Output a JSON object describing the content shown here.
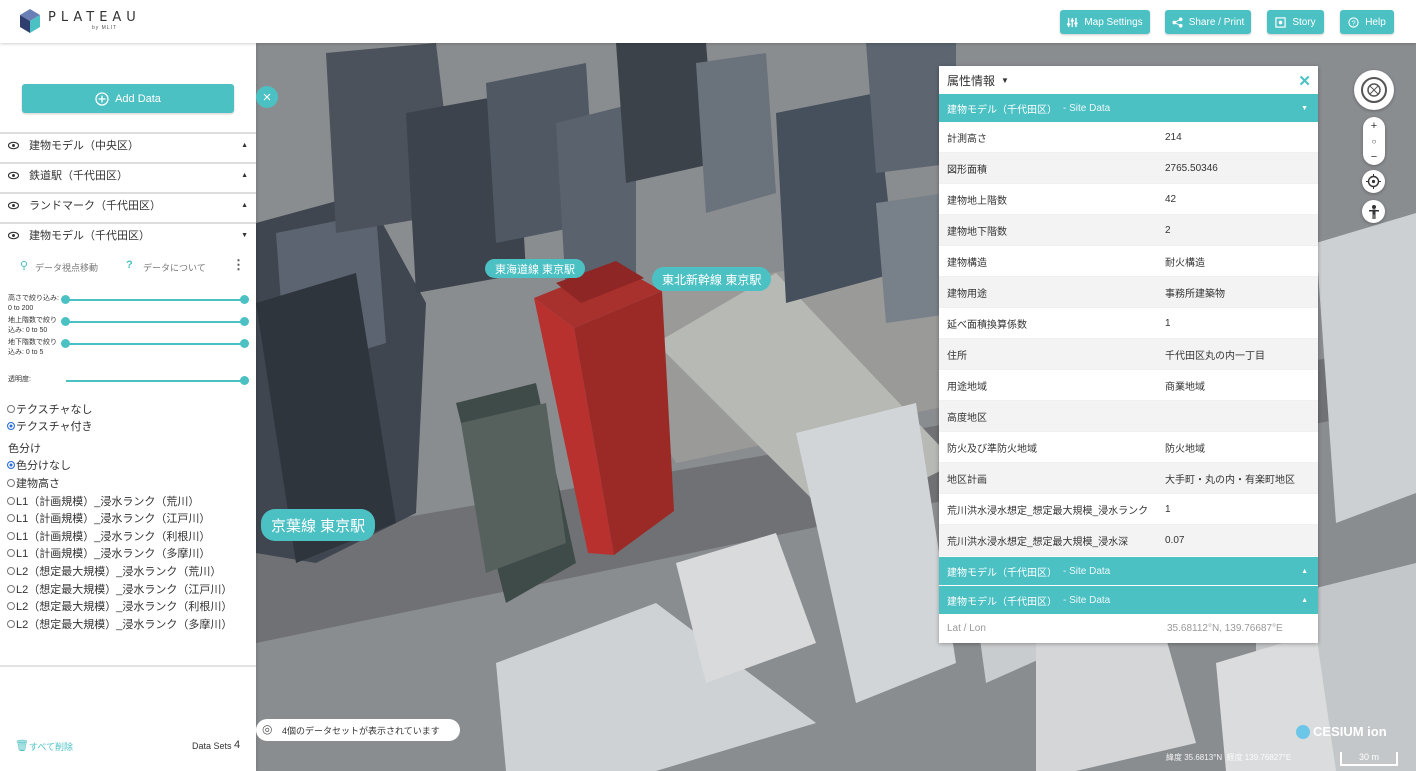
{
  "app": {
    "logo_title": "PLATEAU",
    "logo_sub": "by MLIT"
  },
  "toolbar": {
    "map_settings": "Map Settings",
    "share_print": "Share / Print",
    "story": "Story",
    "help": "Help"
  },
  "sidebar": {
    "add_data": "Add Data",
    "layers": [
      {
        "label": "建物モデル（中央区）",
        "arrow": "▲"
      },
      {
        "label": "鉄道駅（千代田区）",
        "arrow": "▲"
      },
      {
        "label": "ランドマーク（千代田区）",
        "arrow": "▲"
      },
      {
        "label": "建物モデル（千代田区）",
        "arrow": "▼"
      }
    ],
    "tools": {
      "move_view": "データ視点移動",
      "about": "データについて"
    },
    "sliders": [
      {
        "label": "高さで絞り込み:",
        "range": "0 to 200"
      },
      {
        "label": "地上階数で絞り",
        "range": "込み: 0 to 50"
      },
      {
        "label": "地下階数で絞り",
        "range": "込み: 0 to 5"
      }
    ],
    "opacity_label": "透明度:",
    "texture_options": [
      {
        "label": "テクスチャなし",
        "selected": false
      },
      {
        "label": "テクスチャ付き",
        "selected": true
      }
    ],
    "color_heading": "色分け",
    "color_options": [
      {
        "label": "色分けなし",
        "selected": true
      },
      {
        "label": "建物高さ",
        "selected": false
      },
      {
        "label": "L1（計画規模）_浸水ランク（荒川）",
        "selected": false
      },
      {
        "label": "L1（計画規模）_浸水ランク（江戸川）",
        "selected": false
      },
      {
        "label": "L1（計画規模）_浸水ランク（利根川）",
        "selected": false
      },
      {
        "label": "L1（計画規模）_浸水ランク（多摩川）",
        "selected": false
      },
      {
        "label": "L2（想定最大規模）_浸水ランク（荒川）",
        "selected": false
      },
      {
        "label": "L2（想定最大規模）_浸水ランク（江戸川）",
        "selected": false
      },
      {
        "label": "L2（想定最大規模）_浸水ランク（利根川）",
        "selected": false
      },
      {
        "label": "L2（想定最大規模）_浸水ランク（多摩川）",
        "selected": false
      }
    ],
    "delete_all": "すべて削除",
    "data_sets_label": "Data Sets",
    "data_sets_count": "4"
  },
  "map": {
    "labels": {
      "keiyo": "京葉線 東京駅",
      "tokaido": "東海道線 東京駅",
      "tohoku": "東北新幹線 東京駅"
    },
    "status": "4個のデータセットが表示されています",
    "cesium": "CESIUM ion",
    "scale": "30 m",
    "coords_lat": "緯度 35.6813°N",
    "coords_lon": "経度 139.76827°E"
  },
  "feature_info": {
    "title": "属性情報",
    "section_title": "建物モデル（千代田区）",
    "section_sub": "- Site Data",
    "rows": [
      {
        "key": "計測高さ",
        "value": "214"
      },
      {
        "key": "図形面積",
        "value": "2765.50346"
      },
      {
        "key": "建物地上階数",
        "value": "42"
      },
      {
        "key": "建物地下階数",
        "value": "2"
      },
      {
        "key": "建物構造",
        "value": "耐火構造"
      },
      {
        "key": "建物用途",
        "value": "事務所建築物"
      },
      {
        "key": "延べ面積換算係数",
        "value": "1"
      },
      {
        "key": "住所",
        "value": "千代田区丸の内一丁目"
      },
      {
        "key": "用途地域",
        "value": "商業地域"
      },
      {
        "key": "高度地区",
        "value": ""
      },
      {
        "key": "防火及び準防火地域",
        "value": "防火地域"
      },
      {
        "key": "地区計画",
        "value": "大手町・丸の内・有楽町地区"
      },
      {
        "key": "荒川洪水浸水想定_想定最大規模_浸水ランク",
        "value": "1"
      },
      {
        "key": "荒川洪水浸水想定_想定最大規模_浸水深",
        "value": "0.07"
      }
    ],
    "collapsed_sections": [
      {
        "title": "建物モデル（千代田区）",
        "sub": "- Site Data"
      },
      {
        "title": "建物モデル（千代田区）",
        "sub": "- Site Data"
      }
    ],
    "latlon_label": "Lat / Lon",
    "latlon_value": "35.68112°N, 139.76687°E"
  },
  "colors": {
    "accent": "#4cc1c4",
    "selected_building": "#b8312f"
  }
}
